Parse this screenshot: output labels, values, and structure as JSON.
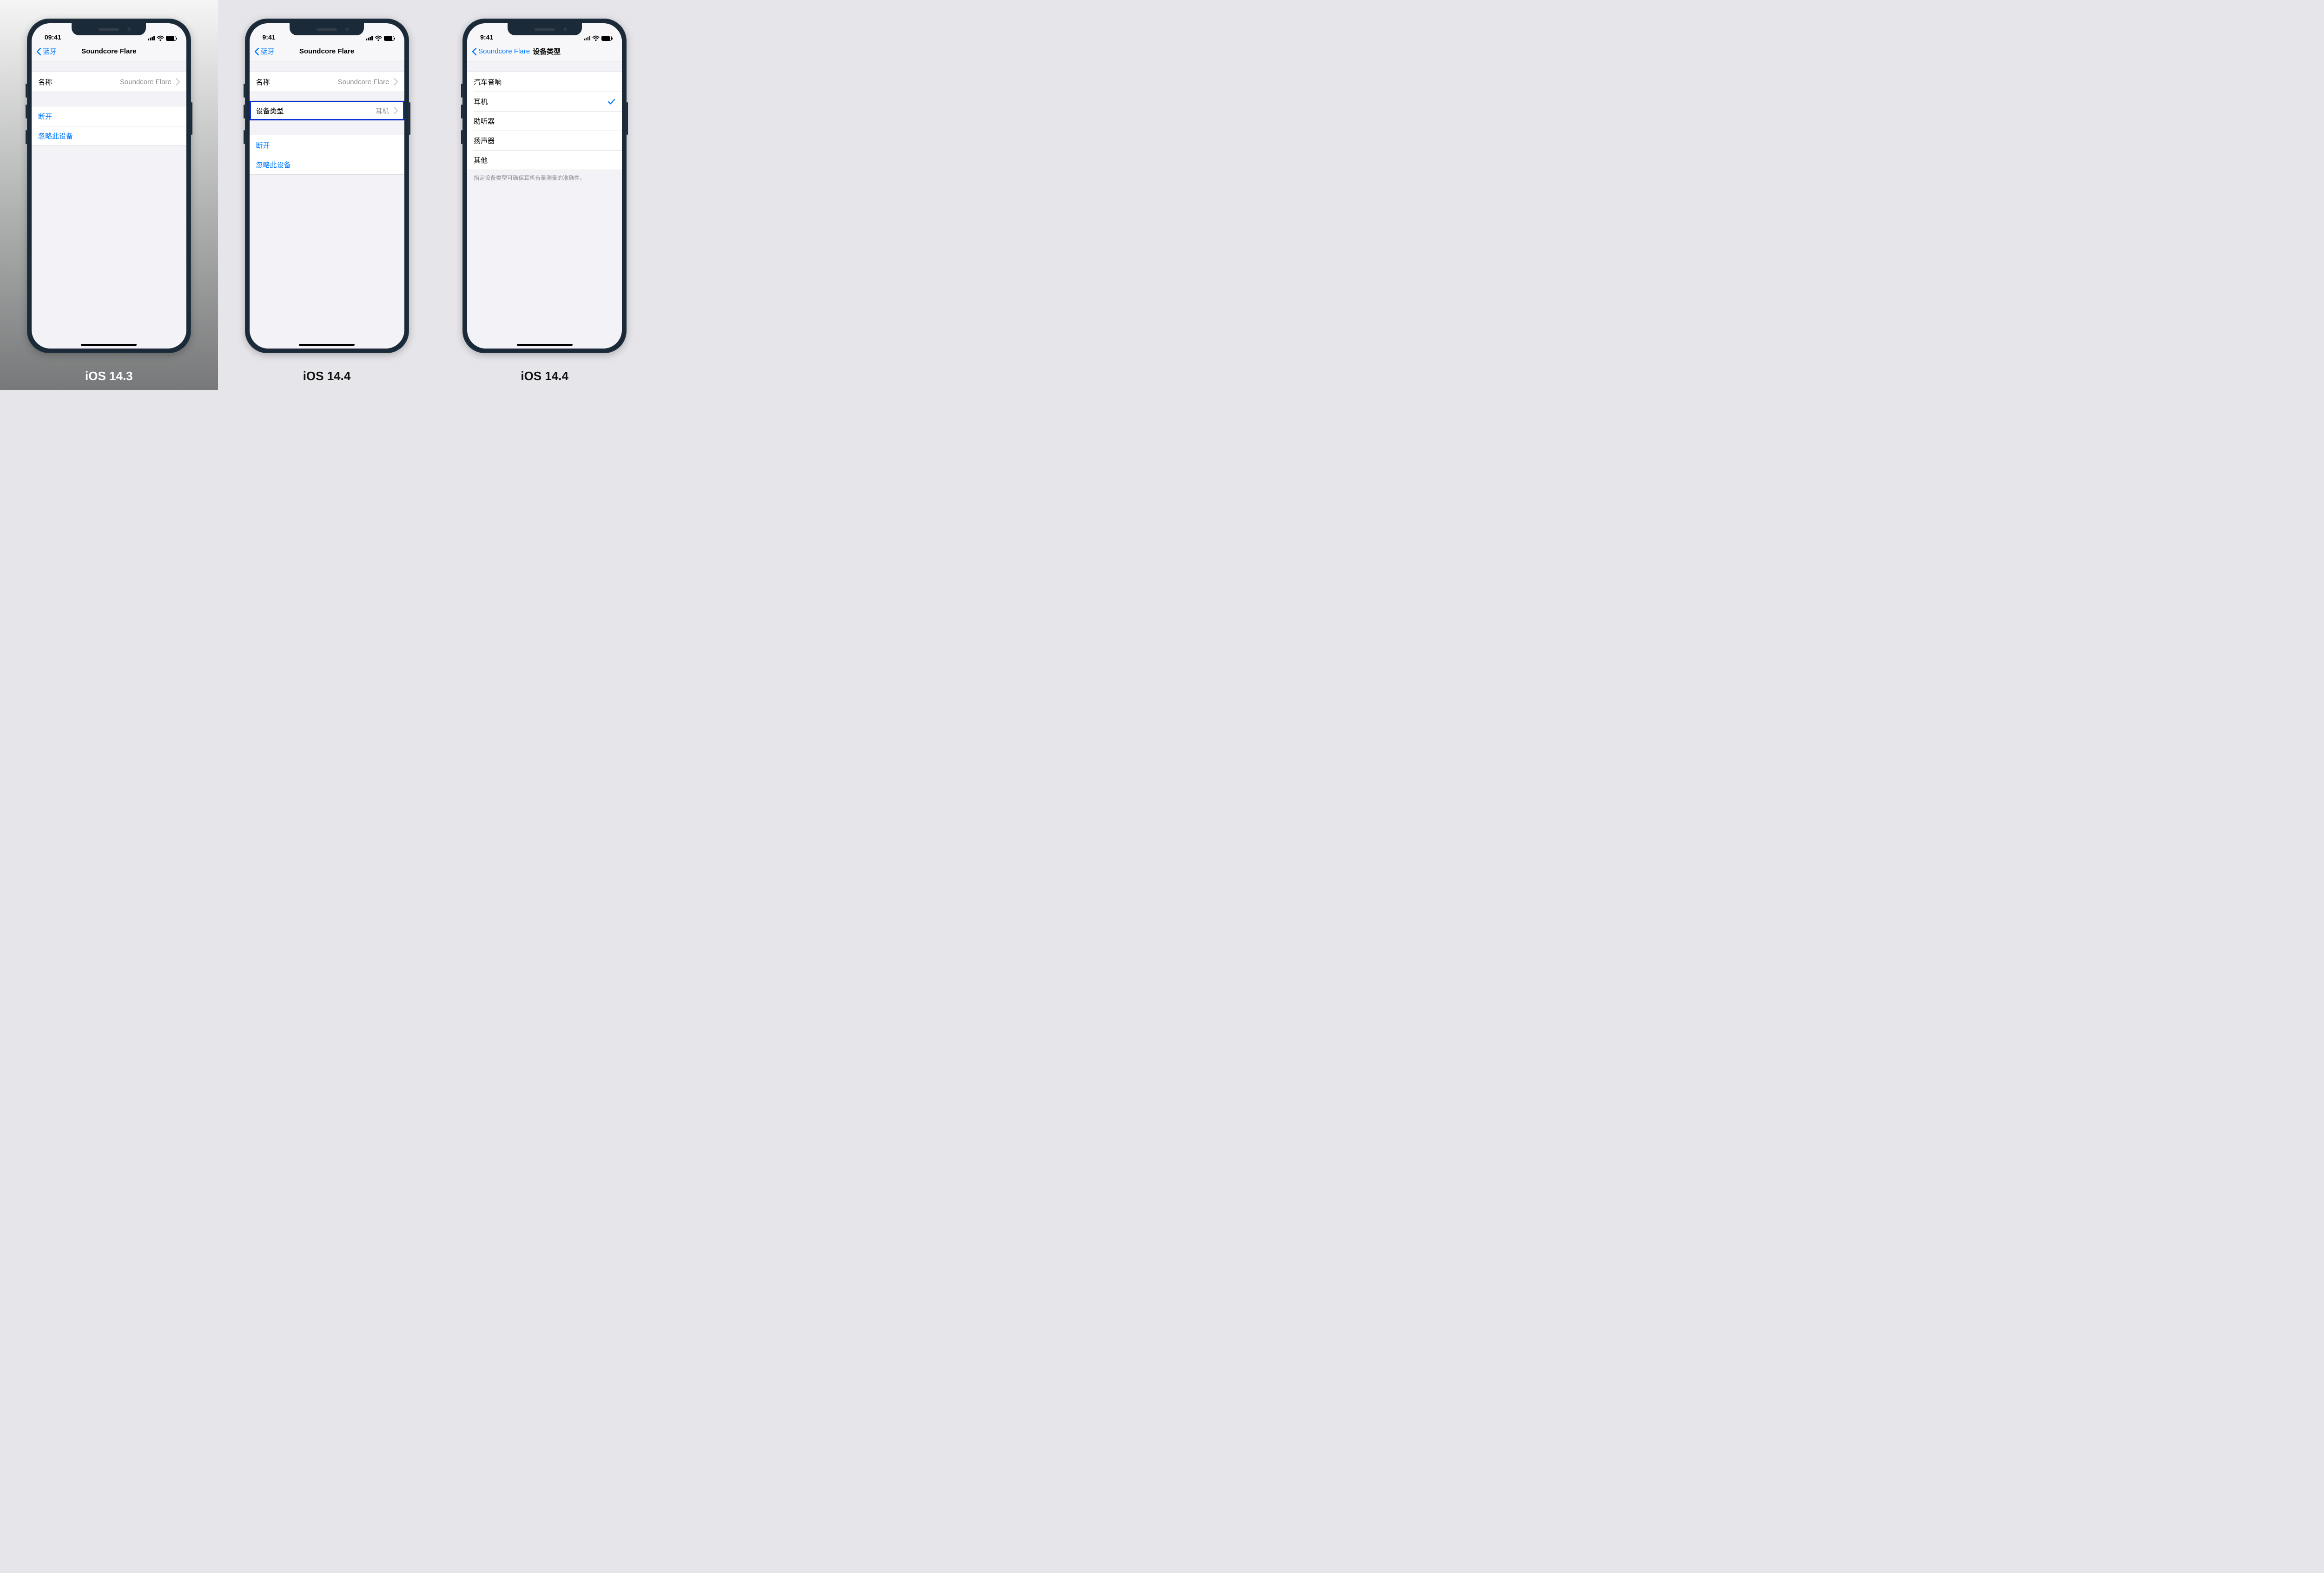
{
  "phone1": {
    "caption": "iOS 14.3",
    "status_time": "09:41",
    "nav_back": "蓝牙",
    "nav_title": "Soundcore Flare",
    "row_name_label": "名称",
    "row_name_value": "Soundcore Flare",
    "row_disconnect": "断开",
    "row_forget": "忽略此设备"
  },
  "phone2": {
    "caption": "iOS 14.4",
    "status_time": "9:41",
    "nav_back": "蓝牙",
    "nav_title": "Soundcore Flare",
    "row_name_label": "名称",
    "row_name_value": "Soundcore Flare",
    "row_type_label": "设备类型",
    "row_type_value": "耳机",
    "row_disconnect": "断开",
    "row_forget": "忽略此设备"
  },
  "phone3": {
    "caption": "iOS 14.4",
    "status_time": "9:41",
    "nav_back": "Soundcore Flare",
    "nav_title": "设备类型",
    "options": {
      "car": "汽车音响",
      "headphone": "耳机",
      "hearingaid": "助听器",
      "speaker": "扬声器",
      "other": "其他"
    },
    "footer": "指定设备类型可确保耳机音量测量的准确性。"
  }
}
